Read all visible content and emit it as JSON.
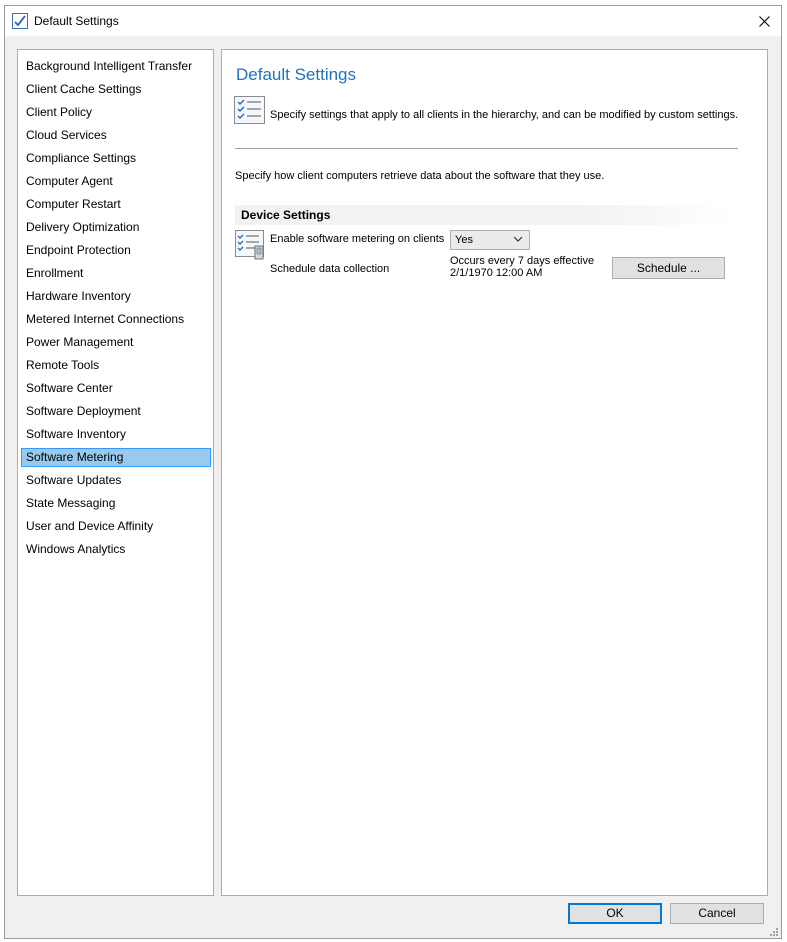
{
  "window": {
    "title": "Default Settings"
  },
  "nav": {
    "items": [
      {
        "label": "Background Intelligent Transfer"
      },
      {
        "label": "Client Cache Settings"
      },
      {
        "label": "Client Policy"
      },
      {
        "label": "Cloud Services"
      },
      {
        "label": "Compliance Settings"
      },
      {
        "label": "Computer Agent"
      },
      {
        "label": "Computer Restart"
      },
      {
        "label": "Delivery Optimization"
      },
      {
        "label": "Endpoint Protection"
      },
      {
        "label": "Enrollment"
      },
      {
        "label": "Hardware Inventory"
      },
      {
        "label": "Metered Internet Connections"
      },
      {
        "label": "Power Management"
      },
      {
        "label": "Remote Tools"
      },
      {
        "label": "Software Center"
      },
      {
        "label": "Software Deployment"
      },
      {
        "label": "Software Inventory"
      },
      {
        "label": "Software Metering"
      },
      {
        "label": "Software Updates"
      },
      {
        "label": "State Messaging"
      },
      {
        "label": "User and Device Affinity"
      },
      {
        "label": "Windows Analytics"
      }
    ],
    "selected": "Software Metering"
  },
  "content": {
    "title": "Default Settings",
    "description": "Specify settings that apply to all clients in the hierarchy, and can be modified by custom settings.",
    "intro": "Specify how client computers retrieve data about the software that they use.",
    "group_header": "Device Settings",
    "enable_label": "Enable software metering on clients",
    "enable_value": "Yes",
    "schedule_label": "Schedule data collection",
    "schedule_line1": "Occurs every 7 days effective",
    "schedule_line2": "2/1/1970 12:00 AM",
    "schedule_button": "Schedule ..."
  },
  "footer": {
    "ok_label": "OK",
    "cancel_label": "Cancel"
  },
  "colors": {
    "accent_title": "#1e73be",
    "selection_bg": "#99c9ef",
    "selection_border": "#3399ff",
    "default_button_border": "#0078d7"
  },
  "icons": [
    "checklist-icon",
    "close-icon",
    "settings-list-icon",
    "setting-item-icon",
    "chevron-down-icon",
    "resize-grip-icon"
  ]
}
